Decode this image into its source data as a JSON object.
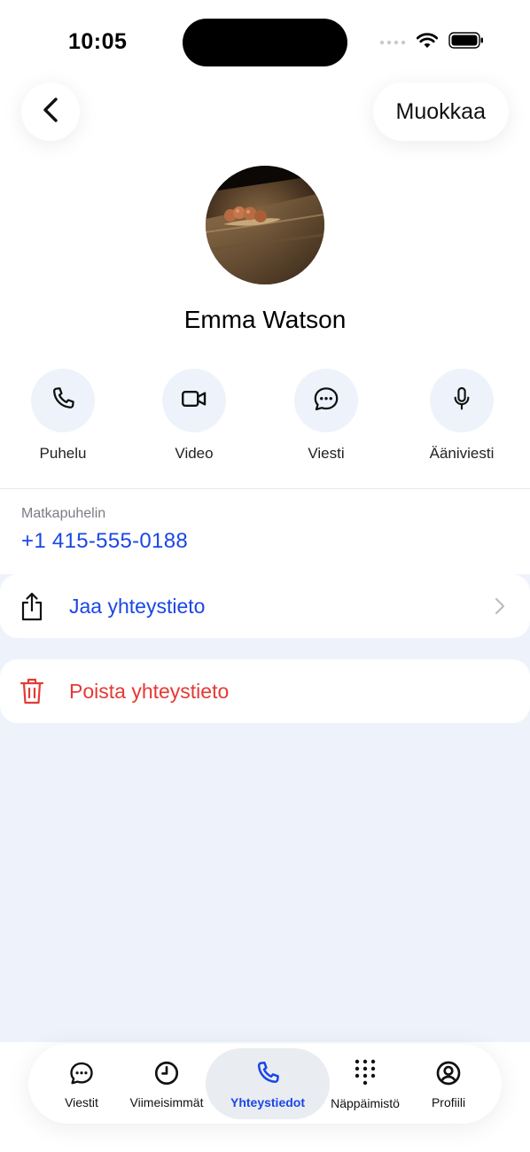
{
  "status_bar": {
    "time": "10:05"
  },
  "header": {
    "back_icon": "chevron-left-icon",
    "edit_label": "Muokkaa"
  },
  "contact": {
    "name": "Emma Watson"
  },
  "actions": [
    {
      "label": "Puhelu",
      "icon": "phone-icon"
    },
    {
      "label": "Video",
      "icon": "video-icon"
    },
    {
      "label": "Viesti",
      "icon": "message-icon"
    },
    {
      "label": "Ääniviesti",
      "icon": "microphone-icon"
    }
  ],
  "phone": {
    "label": "Matkapuhelin",
    "number": "+1 415-555-0188"
  },
  "share_row": {
    "label": "Jaa yhteystieto",
    "icon": "share-icon"
  },
  "delete_row": {
    "label": "Poista yhteystieto",
    "icon": "trash-icon"
  },
  "tabbar": {
    "active": "Yhteystiedot",
    "tabs": [
      {
        "label": "Viestit",
        "icon": "chat-icon"
      },
      {
        "label": "Viimeisimmät",
        "icon": "clock-icon"
      },
      {
        "label": "Yhteystiedot",
        "icon": "phone-icon"
      },
      {
        "label": "Näppäimistö",
        "icon": "keypad-icon"
      },
      {
        "label": "Profiili",
        "icon": "profile-icon"
      }
    ]
  },
  "colors": {
    "accent": "#1a47e5",
    "danger": "#e53935",
    "panel": "#eef3fb"
  }
}
